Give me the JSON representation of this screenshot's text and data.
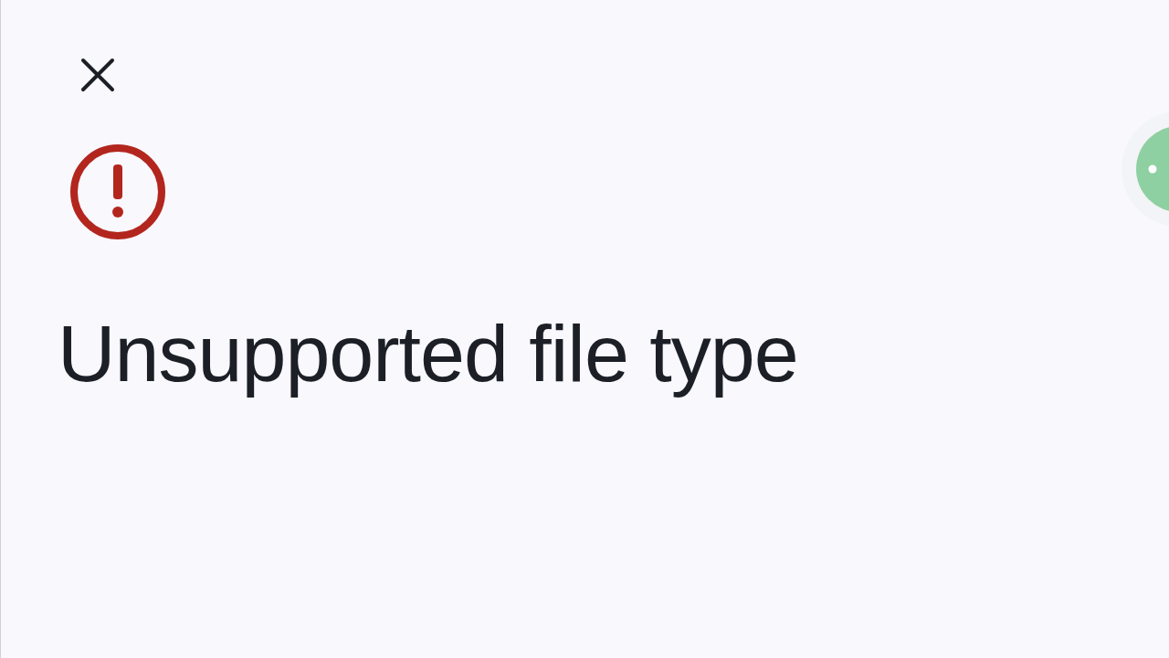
{
  "dialog": {
    "kind": "error",
    "title": "Unsupported file type"
  }
}
